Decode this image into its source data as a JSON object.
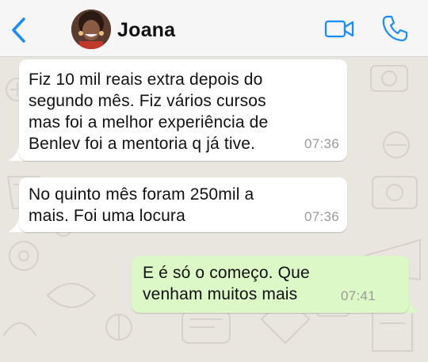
{
  "header": {
    "contact_name": "Joana",
    "icons": [
      "back-chevron-icon",
      "avatar",
      "video-camera-icon",
      "phone-icon"
    ],
    "accent_color": "#1a8cff"
  },
  "messages": [
    {
      "direction": "incoming",
      "text": "Fiz 10 mil reais extra depois do\nsegundo mês. Fiz vários cursos\nmas foi a melhor experiência de\nBenlev foi a mentoria q já tive.",
      "time": "07:36"
    },
    {
      "direction": "incoming",
      "text": "No quinto mês foram 250mil a\nmais. Foi uma locura",
      "time": "07:36"
    },
    {
      "direction": "outgoing",
      "text": "E é só o começo. Que\nvenham muitos mais",
      "time": "07:41"
    }
  ],
  "colors": {
    "incoming_bubble": "#ffffff",
    "outgoing_bubble": "#dcf8c6",
    "chat_background": "#e9e5df",
    "header_background": "#f6f6f6"
  }
}
